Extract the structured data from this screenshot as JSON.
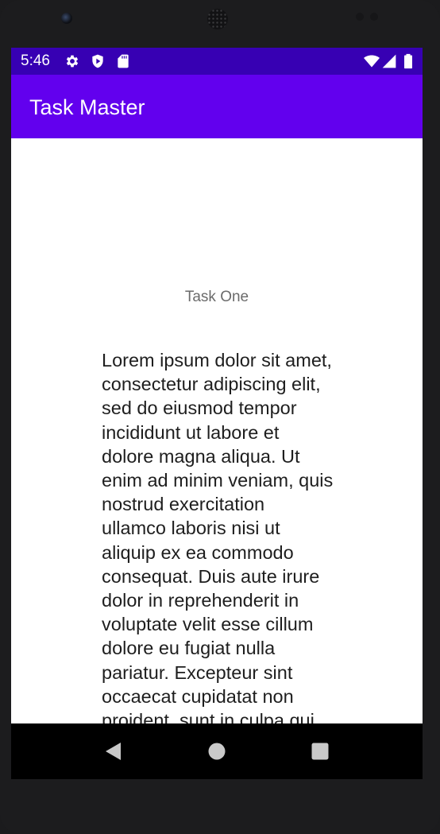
{
  "status_bar": {
    "time": "5:46",
    "left_icons": [
      "settings-gear-icon",
      "shield-play-icon",
      "sd-card-icon"
    ],
    "right_icons": [
      "wifi-icon",
      "cell-signal-icon",
      "battery-icon"
    ]
  },
  "app_bar": {
    "title": "Task Master",
    "color": "#6200ee",
    "status_color": "#3700b3"
  },
  "task": {
    "title": "Task One",
    "body": "Lorem ipsum dolor sit amet, consectetur adipiscing elit, sed do eiusmod tempor incididunt ut labore et dolore magna aliqua. Ut enim ad minim veniam, quis nostrud exercitation ullamco laboris nisi ut aliquip ex ea commodo consequat. Duis aute irure dolor in reprehenderit in voluptate velit esse cillum dolore eu fugiat nulla pariatur. Excepteur sint occaecat cupidatat non proident, sunt in culpa qui officia deserunt mollit anim id est laborum."
  },
  "nav_bar": {
    "buttons": [
      "back-icon",
      "home-icon",
      "recents-icon"
    ]
  }
}
